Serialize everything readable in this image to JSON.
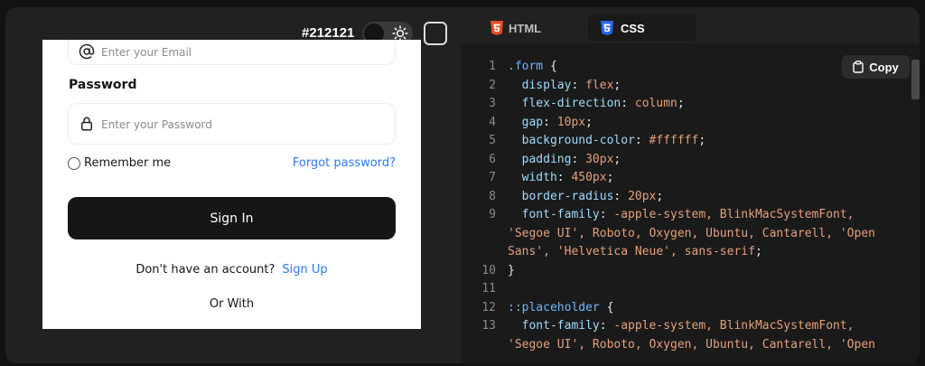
{
  "preview": {
    "color_label": "#212121",
    "form": {
      "email_placeholder": "Enter your Email",
      "password_label": "Password",
      "password_placeholder": "Enter your Password",
      "remember_label": "Remember me",
      "forgot_label": "Forgot password?",
      "signin_label": "Sign In",
      "signup_prompt": "Don't have an account?",
      "signup_link": "Sign Up",
      "or_with": "Or With"
    }
  },
  "code_panel": {
    "tabs": [
      {
        "label": "HTML",
        "icon": "html5-icon",
        "color": "#e44d26",
        "active": false
      },
      {
        "label": "CSS",
        "icon": "css3-icon",
        "color": "#2965f1",
        "active": true
      }
    ],
    "copy_label": "Copy",
    "lines": [
      {
        "n": "1",
        "parts": [
          [
            "sel",
            ".form"
          ],
          [
            "punc",
            " {"
          ]
        ]
      },
      {
        "n": "2",
        "parts": [
          [
            "prop",
            "  display"
          ],
          [
            "punc",
            ": "
          ],
          [
            "val",
            "flex"
          ],
          [
            "punc",
            ";"
          ]
        ]
      },
      {
        "n": "3",
        "parts": [
          [
            "prop",
            "  flex-direction"
          ],
          [
            "punc",
            ": "
          ],
          [
            "val",
            "column"
          ],
          [
            "punc",
            ";"
          ]
        ]
      },
      {
        "n": "4",
        "parts": [
          [
            "prop",
            "  gap"
          ],
          [
            "punc",
            ": "
          ],
          [
            "val",
            "10px"
          ],
          [
            "punc",
            ";"
          ]
        ]
      },
      {
        "n": "5",
        "parts": [
          [
            "prop",
            "  background-color"
          ],
          [
            "punc",
            ": "
          ],
          [
            "val",
            "#ffffff"
          ],
          [
            "punc",
            ";"
          ]
        ]
      },
      {
        "n": "6",
        "parts": [
          [
            "prop",
            "  padding"
          ],
          [
            "punc",
            ": "
          ],
          [
            "val",
            "30px"
          ],
          [
            "punc",
            ";"
          ]
        ]
      },
      {
        "n": "7",
        "parts": [
          [
            "prop",
            "  width"
          ],
          [
            "punc",
            ": "
          ],
          [
            "val",
            "450px"
          ],
          [
            "punc",
            ";"
          ]
        ]
      },
      {
        "n": "8",
        "parts": [
          [
            "prop",
            "  border-radius"
          ],
          [
            "punc",
            ": "
          ],
          [
            "val",
            "20px"
          ],
          [
            "punc",
            ";"
          ]
        ]
      },
      {
        "n": "9",
        "parts": [
          [
            "prop",
            "  font-family"
          ],
          [
            "punc",
            ": "
          ],
          [
            "val",
            "-apple-system, BlinkMacSystemFont,"
          ]
        ]
      },
      {
        "n": "",
        "parts": [
          [
            "val",
            "'Segoe UI', Roboto, Oxygen, Ubuntu, Cantarell, 'Open"
          ]
        ]
      },
      {
        "n": "",
        "parts": [
          [
            "val",
            "Sans', 'Helvetica Neue', sans-serif"
          ],
          [
            "punc",
            ";"
          ]
        ]
      },
      {
        "n": "10",
        "parts": [
          [
            "punc",
            "}"
          ]
        ]
      },
      {
        "n": "11",
        "parts": []
      },
      {
        "n": "12",
        "parts": [
          [
            "sel",
            "::placeholder"
          ],
          [
            "punc",
            " {"
          ]
        ]
      },
      {
        "n": "13",
        "parts": [
          [
            "prop",
            "  font-family"
          ],
          [
            "punc",
            ": "
          ],
          [
            "val",
            "-apple-system, BlinkMacSystemFont,"
          ]
        ]
      },
      {
        "n": "",
        "parts": [
          [
            "val",
            "'Segoe UI', Roboto, Oxygen, Ubuntu, Cantarell, 'Open"
          ]
        ]
      }
    ]
  }
}
